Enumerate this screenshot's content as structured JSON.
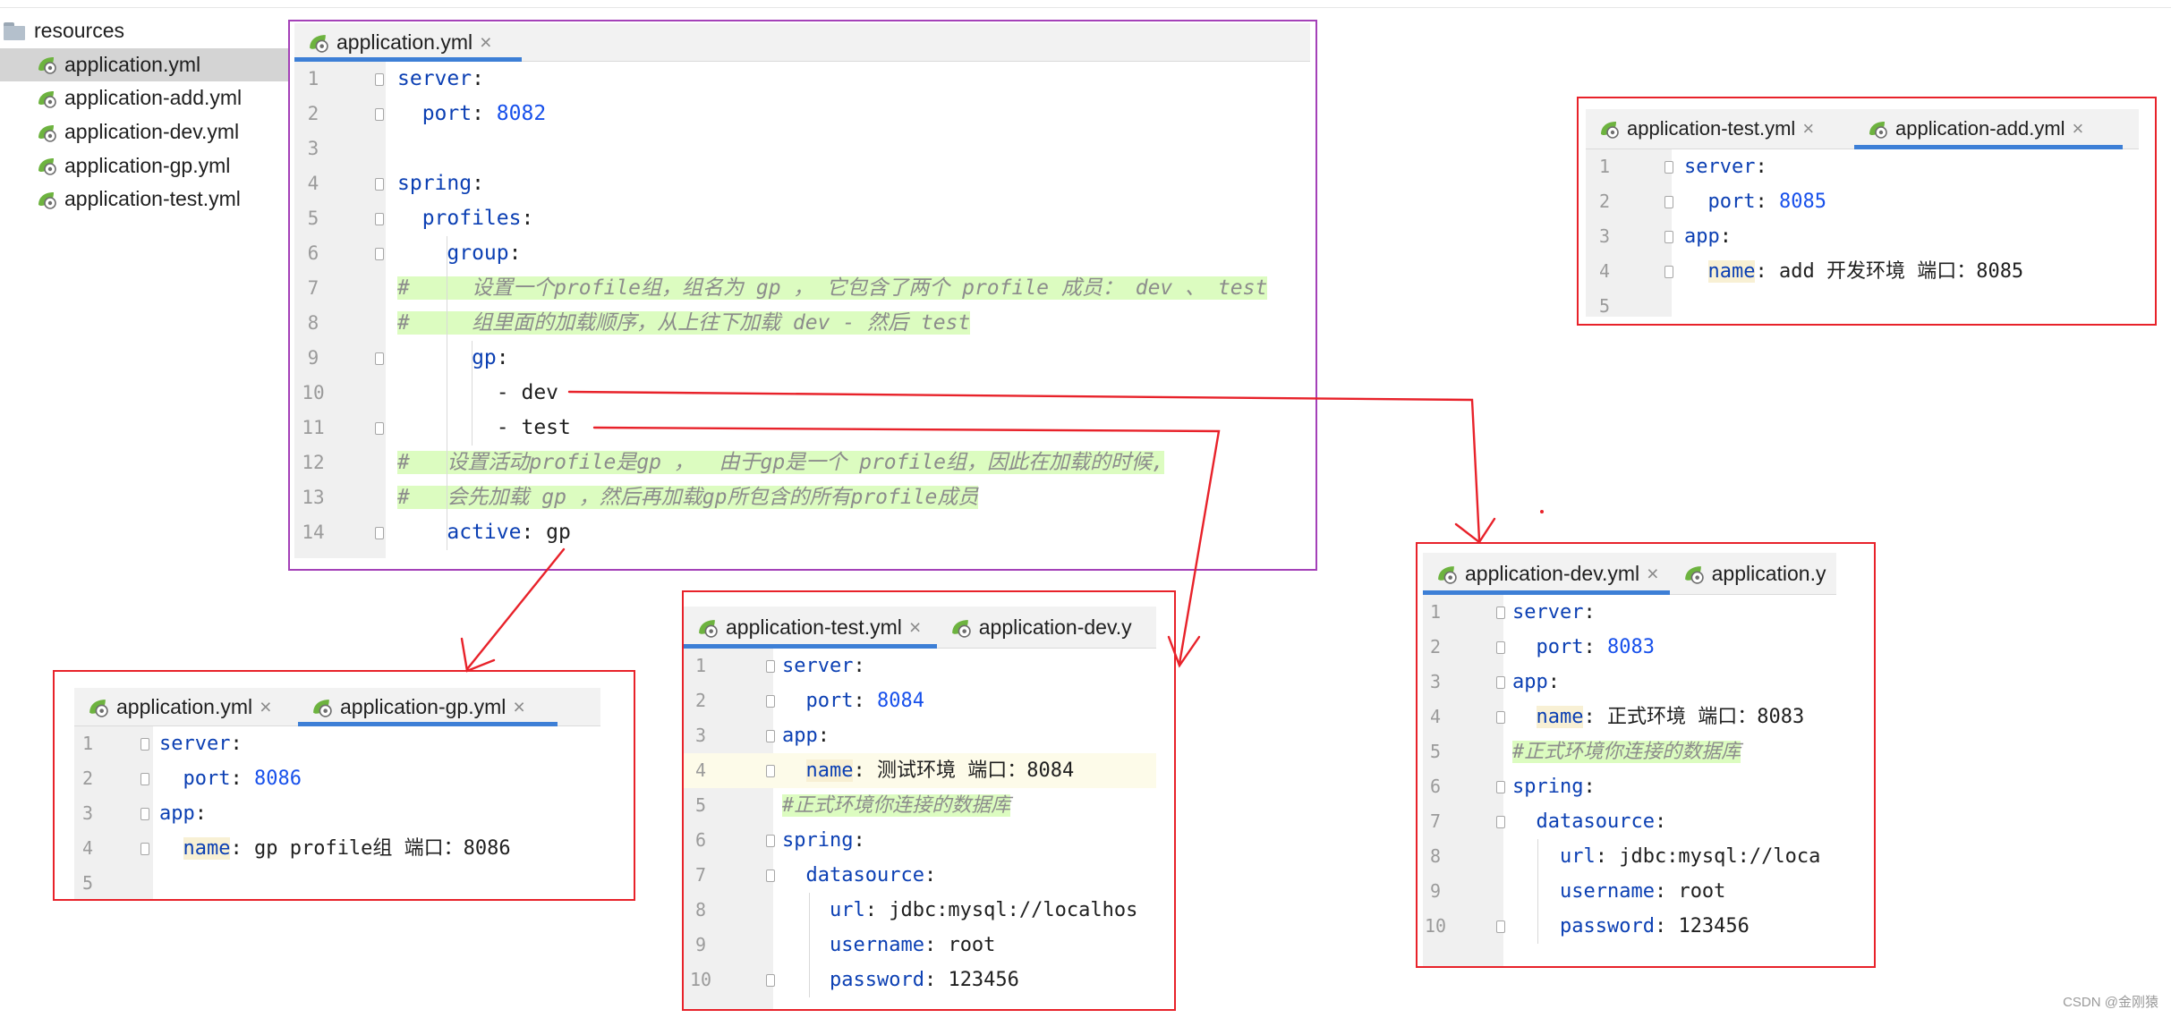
{
  "file_tree": {
    "root": "resources",
    "files": [
      "application.yml",
      "application-add.yml",
      "application-dev.yml",
      "application-gp.yml",
      "application-test.yml"
    ]
  },
  "main_editor": {
    "tabs": [
      {
        "label": "application.yml",
        "close": "×"
      }
    ],
    "lines": [
      {
        "n": "1",
        "parts": [
          {
            "t": "server",
            "c": "key"
          },
          {
            "t": ":",
            "c": "val"
          }
        ]
      },
      {
        "n": "2",
        "parts": [
          {
            "t": "  port",
            "c": "key"
          },
          {
            "t": ": ",
            "c": "val"
          },
          {
            "t": "8082",
            "c": "num"
          }
        ]
      },
      {
        "n": "3",
        "parts": []
      },
      {
        "n": "4",
        "parts": [
          {
            "t": "spring",
            "c": "key"
          },
          {
            "t": ":",
            "c": "val"
          }
        ]
      },
      {
        "n": "5",
        "parts": [
          {
            "t": "  profiles",
            "c": "key"
          },
          {
            "t": ":",
            "c": "val"
          }
        ]
      },
      {
        "n": "6",
        "parts": [
          {
            "t": "    group",
            "c": "key"
          },
          {
            "t": ":",
            "c": "val"
          }
        ]
      },
      {
        "n": "7",
        "parts": [
          {
            "t": "#     设置一个profile组，组名为 gp ， 它包含了两个 profile 成员： dev 、 test",
            "c": "cmt"
          }
        ]
      },
      {
        "n": "8",
        "parts": [
          {
            "t": "#     组里面的加载顺序，从上往下加载 dev - 然后 test",
            "c": "cmt"
          }
        ]
      },
      {
        "n": "9",
        "parts": [
          {
            "t": "      gp",
            "c": "key"
          },
          {
            "t": ":",
            "c": "val"
          }
        ]
      },
      {
        "n": "10",
        "parts": [
          {
            "t": "        - dev",
            "c": "val"
          }
        ]
      },
      {
        "n": "11",
        "parts": [
          {
            "t": "        - test",
            "c": "val"
          }
        ]
      },
      {
        "n": "12",
        "parts": [
          {
            "t": "#   设置活动profile是gp ，  由于gp是一个 profile组，因此在加载的时候,",
            "c": "cmt"
          }
        ]
      },
      {
        "n": "13",
        "parts": [
          {
            "t": "#   会先加载 gp ，然后再加载gp所包含的所有profile成员",
            "c": "cmt"
          }
        ]
      },
      {
        "n": "14",
        "parts": [
          {
            "t": "    active",
            "c": "key"
          },
          {
            "t": ": gp",
            "c": "val"
          }
        ]
      }
    ]
  },
  "add_editor": {
    "tabs": [
      {
        "label": "application-test.yml",
        "close": "×"
      },
      {
        "label": "application-add.yml",
        "close": "×"
      }
    ],
    "lines": [
      {
        "n": "1",
        "parts": [
          {
            "t": "server",
            "c": "key"
          },
          {
            "t": ":",
            "c": "val"
          }
        ]
      },
      {
        "n": "2",
        "parts": [
          {
            "t": "  port",
            "c": "key"
          },
          {
            "t": ": ",
            "c": "val"
          },
          {
            "t": "8085",
            "c": "num"
          }
        ]
      },
      {
        "n": "3",
        "parts": [
          {
            "t": "app",
            "c": "key"
          },
          {
            "t": ":",
            "c": "val"
          }
        ]
      },
      {
        "n": "4",
        "parts": [
          {
            "t": "  ",
            "c": "val"
          },
          {
            "t": "name",
            "c": "key hl"
          },
          {
            "t": ": add 开发环境 端口：8085",
            "c": "val"
          }
        ]
      },
      {
        "n": "5",
        "parts": []
      }
    ]
  },
  "gp_editor": {
    "tabs": [
      {
        "label": "application.yml",
        "close": "×"
      },
      {
        "label": "application-gp.yml",
        "close": "×"
      }
    ],
    "lines": [
      {
        "n": "1",
        "parts": [
          {
            "t": "server",
            "c": "key"
          },
          {
            "t": ":",
            "c": "val"
          }
        ]
      },
      {
        "n": "2",
        "parts": [
          {
            "t": "  port",
            "c": "key"
          },
          {
            "t": ": ",
            "c": "val"
          },
          {
            "t": "8086",
            "c": "num"
          }
        ]
      },
      {
        "n": "3",
        "parts": [
          {
            "t": "app",
            "c": "key"
          },
          {
            "t": ":",
            "c": "val"
          }
        ]
      },
      {
        "n": "4",
        "parts": [
          {
            "t": "  ",
            "c": "val"
          },
          {
            "t": "name",
            "c": "key hl"
          },
          {
            "t": ": gp profile组 端口：8086",
            "c": "val"
          }
        ]
      },
      {
        "n": "5",
        "parts": []
      }
    ]
  },
  "test_editor": {
    "tabs": [
      {
        "label": "application-test.yml",
        "close": "×"
      },
      {
        "label": "application-dev.y",
        "close": ""
      }
    ],
    "lines": [
      {
        "n": "1",
        "parts": [
          {
            "t": "server",
            "c": "key"
          },
          {
            "t": ":",
            "c": "val"
          }
        ]
      },
      {
        "n": "2",
        "parts": [
          {
            "t": "  port",
            "c": "key"
          },
          {
            "t": ": ",
            "c": "val"
          },
          {
            "t": "8084",
            "c": "num"
          }
        ]
      },
      {
        "n": "3",
        "parts": [
          {
            "t": "app",
            "c": "key"
          },
          {
            "t": ":",
            "c": "val"
          }
        ]
      },
      {
        "n": "4",
        "parts": [
          {
            "t": "  ",
            "c": "val"
          },
          {
            "t": "name",
            "c": "key hl"
          },
          {
            "t": ": 测试环境 端口：8084",
            "c": "val"
          }
        ]
      },
      {
        "n": "5",
        "parts": [
          {
            "t": "#正式环境你连接的数据库",
            "c": "cmt"
          }
        ]
      },
      {
        "n": "6",
        "parts": [
          {
            "t": "spring",
            "c": "key"
          },
          {
            "t": ":",
            "c": "val"
          }
        ]
      },
      {
        "n": "7",
        "parts": [
          {
            "t": "  datasource",
            "c": "key"
          },
          {
            "t": ":",
            "c": "val"
          }
        ]
      },
      {
        "n": "8",
        "parts": [
          {
            "t": "    url",
            "c": "key"
          },
          {
            "t": ": jdbc:mysql://localhos",
            "c": "val"
          }
        ]
      },
      {
        "n": "9",
        "parts": [
          {
            "t": "    username",
            "c": "key"
          },
          {
            "t": ": root",
            "c": "val"
          }
        ]
      },
      {
        "n": "10",
        "parts": [
          {
            "t": "    password",
            "c": "key"
          },
          {
            "t": ": 123456",
            "c": "val"
          }
        ]
      }
    ]
  },
  "dev_editor": {
    "tabs": [
      {
        "label": "application-dev.yml",
        "close": "×"
      },
      {
        "label": "application.y",
        "close": ""
      }
    ],
    "lines": [
      {
        "n": "1",
        "parts": [
          {
            "t": "server",
            "c": "key"
          },
          {
            "t": ":",
            "c": "val"
          }
        ]
      },
      {
        "n": "2",
        "parts": [
          {
            "t": "  port",
            "c": "key"
          },
          {
            "t": ": ",
            "c": "val"
          },
          {
            "t": "8083",
            "c": "num"
          }
        ]
      },
      {
        "n": "3",
        "parts": [
          {
            "t": "app",
            "c": "key"
          },
          {
            "t": ":",
            "c": "val"
          }
        ]
      },
      {
        "n": "4",
        "parts": [
          {
            "t": "  ",
            "c": "val"
          },
          {
            "t": "name",
            "c": "key hl"
          },
          {
            "t": ": 正式环境 端口：8083",
            "c": "val"
          }
        ]
      },
      {
        "n": "5",
        "parts": [
          {
            "t": "#正式环境你连接的数据库",
            "c": "cmt"
          }
        ]
      },
      {
        "n": "6",
        "parts": [
          {
            "t": "spring",
            "c": "key"
          },
          {
            "t": ":",
            "c": "val"
          }
        ]
      },
      {
        "n": "7",
        "parts": [
          {
            "t": "  datasource",
            "c": "key"
          },
          {
            "t": ":",
            "c": "val"
          }
        ]
      },
      {
        "n": "8",
        "parts": [
          {
            "t": "    url",
            "c": "key"
          },
          {
            "t": ": jdbc:mysql://loca",
            "c": "val"
          }
        ]
      },
      {
        "n": "9",
        "parts": [
          {
            "t": "    username",
            "c": "key"
          },
          {
            "t": ": root",
            "c": "val"
          }
        ]
      },
      {
        "n": "10",
        "parts": [
          {
            "t": "    password",
            "c": "key"
          },
          {
            "t": ": 123456",
            "c": "val"
          }
        ]
      }
    ]
  },
  "colors": {
    "annotation_red": "#e8222a",
    "main_border": "#a441b8",
    "tab_underline": "#3d7fd6",
    "yaml_key": "#0b3fb3",
    "yaml_number": "#1750eb",
    "comment_bg": "#dcfcc0"
  },
  "watermark": "CSDN @金刚猿"
}
